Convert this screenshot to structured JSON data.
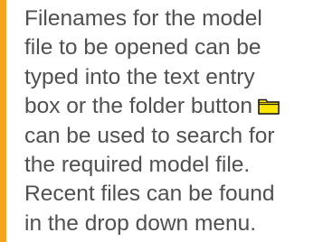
{
  "help_panel": {
    "lines": [
      "Filenames for the model",
      "file to be opened can be",
      "typed into the text entry",
      "box or the folder button",
      "can be used to search for",
      "the required model file.",
      "Recent files can be found",
      "in the drop down menu."
    ],
    "folder_icon": "folder-icon"
  },
  "colors": {
    "accent_bar": "#f7a21b",
    "text": "#505050",
    "folder_fill": "#ffe600",
    "folder_outline": "#1a1a1a"
  }
}
